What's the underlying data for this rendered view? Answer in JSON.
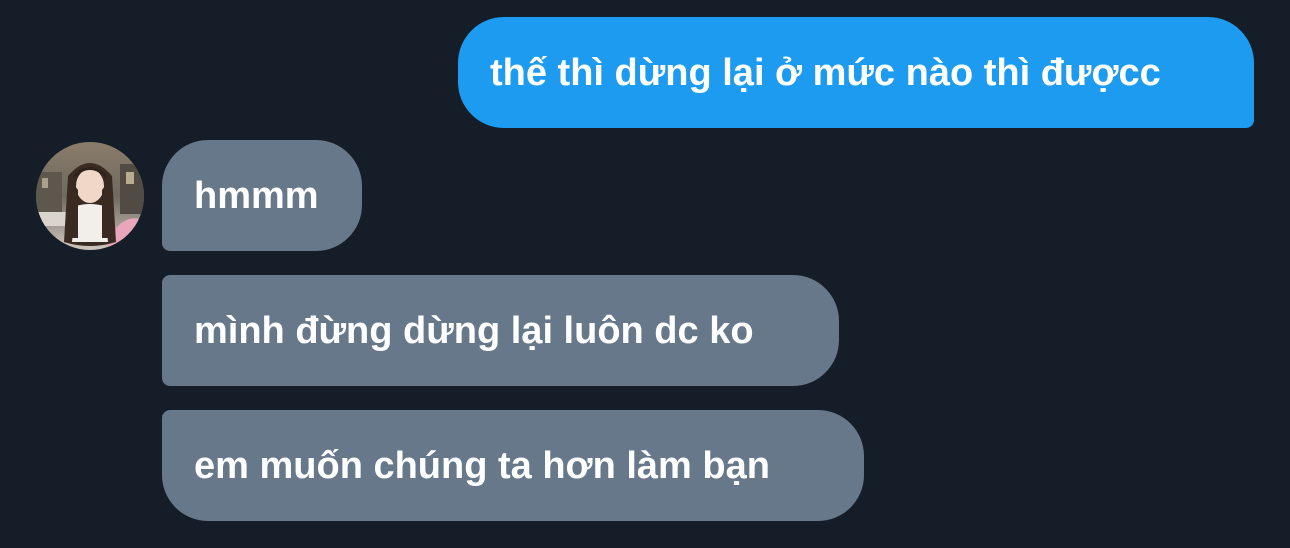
{
  "conversation": {
    "messages": [
      {
        "sender": "me",
        "text": "thế thì dừng lại ở mức nào thì đượcc"
      },
      {
        "sender": "contact",
        "text": "hmmm"
      },
      {
        "sender": "contact",
        "text": "mình đừng dừng lại luôn dc ko"
      },
      {
        "sender": "contact",
        "text": "em muốn chúng ta hơn làm bạn"
      }
    ]
  },
  "contact": {
    "avatar_icon": "contact-avatar"
  },
  "colors": {
    "background": "#151e28",
    "outgoing_bubble": "#1d9bf0",
    "incoming_bubble": "#66788a",
    "text": "#ffffff"
  }
}
